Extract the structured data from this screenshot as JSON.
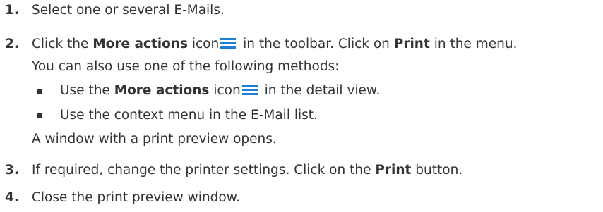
{
  "steps": [
    {
      "number": "1.",
      "text": "Select one or several E-Mails."
    },
    {
      "number": "2.",
      "pre": "Click the ",
      "bold1": "More actions",
      "mid": " icon",
      "mid2": " in the toolbar. Click on ",
      "bold2": "Print",
      "post": " in the menu.",
      "note": "You can also use one of the following methods:",
      "bullets": [
        {
          "pre": "Use the ",
          "bold": "More actions",
          "mid": " icon",
          "post": " in the detail view."
        },
        {
          "text": "Use the context menu in the E-Mail list."
        }
      ],
      "result": "A window with a print preview opens."
    },
    {
      "number": "3.",
      "pre": "If required, change the printer settings. Click on the ",
      "bold": "Print",
      "post": " button."
    },
    {
      "number": "4.",
      "text": "Close the print preview window."
    }
  ],
  "icons": {
    "more_actions": "hamburger-menu-icon"
  },
  "colors": {
    "text": "#333333",
    "icon": "#1f7fd6"
  }
}
